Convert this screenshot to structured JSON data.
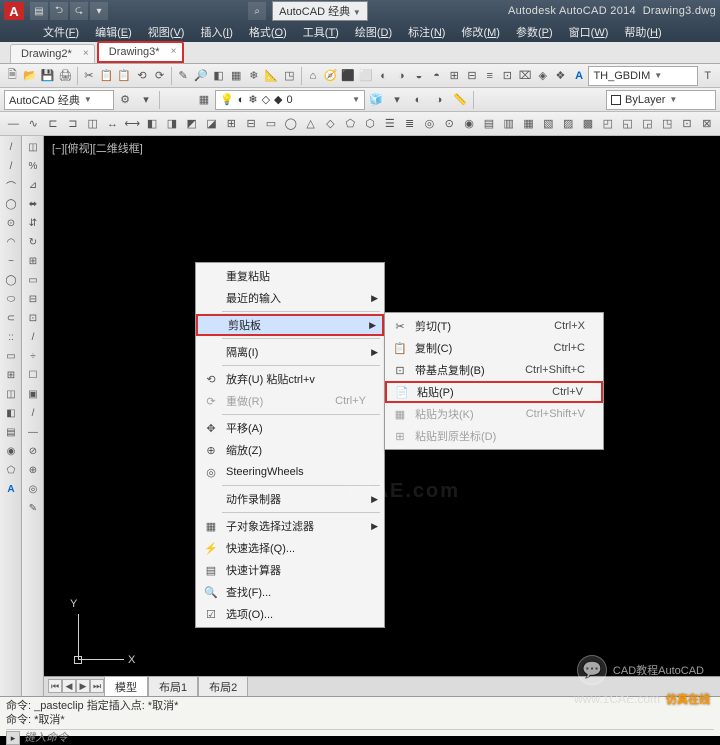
{
  "title": {
    "app": "Autodesk AutoCAD 2014",
    "file": "Drawing3.dwg",
    "logo": "A",
    "workspace": "AutoCAD 经典"
  },
  "qat": [
    "▤",
    "⮌",
    "⮎",
    "▾",
    "⌕"
  ],
  "menus": [
    {
      "t": "文件",
      "k": "F"
    },
    {
      "t": "编辑",
      "k": "E"
    },
    {
      "t": "视图",
      "k": "V"
    },
    {
      "t": "插入",
      "k": "I"
    },
    {
      "t": "格式",
      "k": "O"
    },
    {
      "t": "工具",
      "k": "T"
    },
    {
      "t": "绘图",
      "k": "D"
    },
    {
      "t": "标注",
      "k": "N"
    },
    {
      "t": "修改",
      "k": "M"
    },
    {
      "t": "参数",
      "k": "P"
    },
    {
      "t": "窗口",
      "k": "W"
    },
    {
      "t": "帮助",
      "k": "H"
    }
  ],
  "doc_tabs": [
    {
      "label": "Drawing2*",
      "active": false
    },
    {
      "label": "Drawing3*",
      "active": true,
      "highlight": true
    }
  ],
  "tb1": [
    "🗎",
    "📂",
    "💾",
    "🖨",
    "✂",
    "📋",
    "📋",
    "⟲",
    "⟳",
    "✎",
    "🔎",
    "◧",
    "▦",
    "❄",
    "📐",
    "◳",
    "⌂",
    "🧭",
    "⬛",
    "⬜",
    "◐",
    "◑",
    "◒",
    "◓",
    "⊞",
    "⊟",
    "≡",
    "⊡",
    "⌧",
    "◈",
    "❖"
  ],
  "tb1_right": {
    "textstyle_icon": "A",
    "textstyle": "TH_GBDIM",
    "more": "T"
  },
  "tb2": {
    "ws_label": "AutoCAD 经典",
    "layer0": "0",
    "bylayer": "ByLayer",
    "icons1": [
      "⚙",
      "▾"
    ],
    "icons2": [
      "▦",
      "💡",
      "◐",
      "❄",
      "◇",
      "◆",
      "▾"
    ],
    "icons3": [
      "🧊",
      "▾",
      "◐",
      "◑",
      "📏"
    ]
  },
  "tb3": [
    "—",
    "∿",
    "⊏",
    "⊐",
    "◫",
    "↔",
    "⟷",
    "◧",
    "◨",
    "◩",
    "◪",
    "⊞",
    "⊟",
    "▭",
    "◯",
    "△",
    "◇",
    "⬠",
    "⬡",
    "☰",
    "≣",
    "◎",
    "⊙",
    "◉",
    "▤",
    "▥",
    "▦",
    "▧",
    "▨",
    "▩",
    "◰",
    "◱",
    "◲",
    "◳",
    "⊡",
    "⊠"
  ],
  "left_palette": [
    "/",
    "/",
    "⌒",
    "◯",
    "⊙",
    "◠",
    "~",
    "◯",
    "⬭",
    "⊂",
    "::",
    "▭",
    "⊞",
    "◫",
    "◧",
    "▤",
    "◉",
    "⬠",
    "A"
  ],
  "left_palette2": [
    "◫",
    "%",
    "⊿",
    "⬌",
    "⇵",
    "↻",
    "⊞",
    "▭",
    "⊟",
    "⊡",
    "/",
    "÷",
    "☐",
    "▣",
    "/",
    "—",
    "⊘",
    "⊕",
    "◎",
    "✎"
  ],
  "view_tag": "[−][俯视][二维线框]",
  "layout_tabs": [
    "模型",
    "布局1",
    "布局2"
  ],
  "layout_nav": [
    "⏮",
    "◀",
    "▶",
    "⏭"
  ],
  "ucs": {
    "x": "X",
    "y": "Y"
  },
  "cmd": {
    "l1": "命令: _pasteclip 指定插入点: *取消*",
    "l2": "命令: *取消*",
    "prompt": "键入命令",
    "icon": "▸"
  },
  "ctx1": [
    {
      "type": "item",
      "label": "重复粘贴"
    },
    {
      "type": "item",
      "label": "最近的输入",
      "sub": true
    },
    {
      "type": "sep"
    },
    {
      "type": "item",
      "label": "剪贴板",
      "sub": true,
      "highlight": true,
      "hl": true
    },
    {
      "type": "sep"
    },
    {
      "type": "item",
      "label": "隔离(I)",
      "sub": true
    },
    {
      "type": "sep"
    },
    {
      "type": "item",
      "icon": "⟲",
      "label": "放弃(U) 粘贴ctrl+v"
    },
    {
      "type": "item",
      "icon": "⟳",
      "label": "重做(R)",
      "sc": "Ctrl+Y",
      "disabled": true
    },
    {
      "type": "sep"
    },
    {
      "type": "item",
      "icon": "✥",
      "label": "平移(A)"
    },
    {
      "type": "item",
      "icon": "⊕",
      "label": "缩放(Z)"
    },
    {
      "type": "item",
      "icon": "◎",
      "label": "SteeringWheels"
    },
    {
      "type": "sep"
    },
    {
      "type": "item",
      "label": "动作录制器",
      "sub": true
    },
    {
      "type": "sep"
    },
    {
      "type": "item",
      "icon": "▦",
      "label": "子对象选择过滤器",
      "sub": true
    },
    {
      "type": "item",
      "icon": "⚡",
      "label": "快速选择(Q)..."
    },
    {
      "type": "item",
      "icon": "▤",
      "label": "快速计算器"
    },
    {
      "type": "item",
      "icon": "🔍",
      "label": "查找(F)..."
    },
    {
      "type": "item",
      "icon": "☑",
      "label": "选项(O)..."
    }
  ],
  "ctx2": [
    {
      "icon": "✂",
      "label": "剪切(T)",
      "sc": "Ctrl+X"
    },
    {
      "icon": "📋",
      "label": "复制(C)",
      "sc": "Ctrl+C"
    },
    {
      "icon": "⊡",
      "label": "带基点复制(B)",
      "sc": "Ctrl+Shift+C"
    },
    {
      "icon": "📄",
      "label": "粘贴(P)",
      "sc": "Ctrl+V",
      "highlight": true
    },
    {
      "icon": "▦",
      "label": "粘贴为块(K)",
      "sc": "Ctrl+Shift+V",
      "disabled": true
    },
    {
      "icon": "⊞",
      "label": "粘贴到原坐标(D)",
      "disabled": true
    }
  ],
  "brand_wm": "1CAE.com",
  "wm1": {
    "pre": "CAD教程AutoCAD"
  },
  "wm2": {
    "url": "www.1CAE.com",
    "label": "仿真在线"
  }
}
